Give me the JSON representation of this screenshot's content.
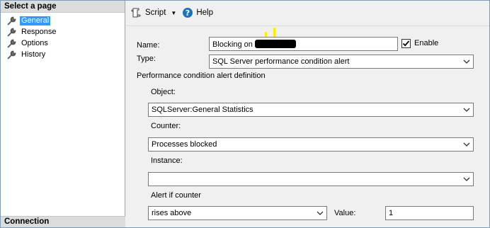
{
  "sidebar": {
    "header": "Select a page",
    "items": [
      {
        "label": "General",
        "icon": "wrench-icon"
      },
      {
        "label": "Response",
        "icon": "wrench-icon"
      },
      {
        "label": "Options",
        "icon": "wrench-icon"
      },
      {
        "label": "History",
        "icon": "wrench-icon"
      }
    ],
    "footer": "Connection"
  },
  "toolbar": {
    "script_label": "Script",
    "help_label": "Help"
  },
  "form": {
    "name_label": "Name:",
    "name_value": "Blocking on",
    "enable_label": "Enable",
    "enable_checked": true,
    "type_label": "Type:",
    "type_value": "SQL Server performance condition alert",
    "definition_label": "Performance condition alert definition",
    "object_label": "Object:",
    "object_value": "SQLServer:General Statistics",
    "counter_label": "Counter:",
    "counter_value": "Processes blocked",
    "instance_label": "Instance:",
    "instance_value": "",
    "alert_if_label": "Alert if counter",
    "alert_if_value": "rises above",
    "value_label": "Value:",
    "value_value": "1"
  },
  "colors": {
    "selection": "#3399ff",
    "help_icon": "#1e73be",
    "highlight": "#ffee00"
  }
}
